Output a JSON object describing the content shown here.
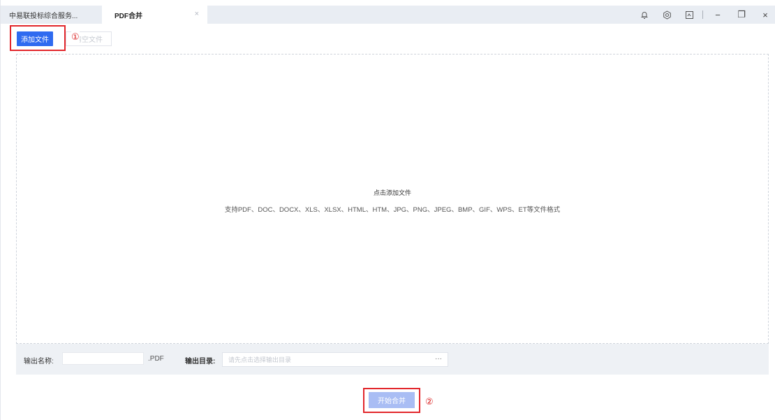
{
  "tabs": [
    {
      "label": "中易联投标综合服务..."
    },
    {
      "label": "PDF合并",
      "close": "×"
    }
  ],
  "titlebar_icons": [
    "bell-icon",
    "settings-icon",
    "display-icon"
  ],
  "window_controls": {
    "minimize": "−",
    "maximize": "❐",
    "close": "×"
  },
  "toolbar": {
    "add_file_label": "添加文件",
    "clear_file_label": "清空文件"
  },
  "annotations": {
    "step1": "①",
    "step2": "②"
  },
  "dropzone": {
    "title": "点击添加文件",
    "subtitle": "支持PDF、DOC、DOCX、XLS、XLSX、HTML、HTM、JPG、PNG、JPEG、BMP、GIF、WPS、ET等文件格式"
  },
  "output": {
    "name_label": "输出名称:",
    "name_value": "",
    "ext": ".PDF",
    "dir_label": "输出目录:",
    "dir_placeholder": "请先点击选择输出目录",
    "dir_more": "···"
  },
  "start_label": "开始合并",
  "colors": {
    "primary": "#2f6bf0",
    "disabled_primary": "#a9bdf4",
    "annotation": "#e2262b"
  }
}
